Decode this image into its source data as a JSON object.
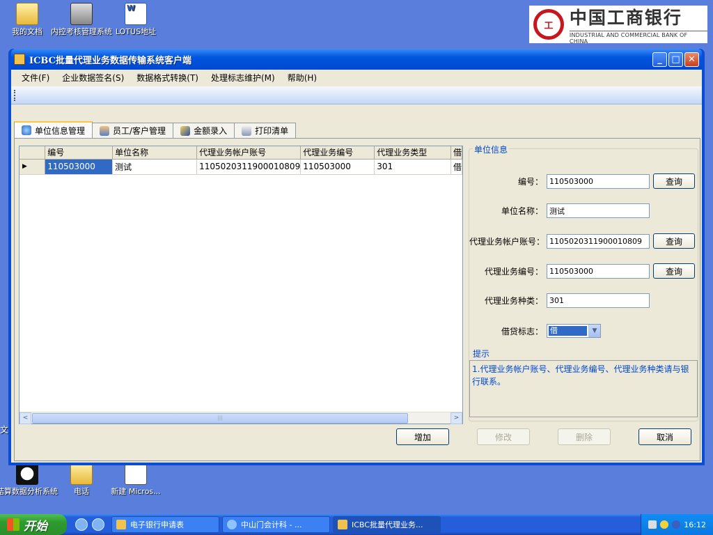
{
  "desktop": {
    "icons": [
      {
        "label": "我的文档"
      },
      {
        "label": "内控考核管理系统"
      },
      {
        "label": "LOTUS地址"
      },
      {
        "label": "结算数据分析系统"
      },
      {
        "label": "电话"
      },
      {
        "label": "新建 Micros..."
      }
    ],
    "side_char": "文"
  },
  "bank_logo": {
    "seal_text": "ICBC",
    "name_cn": "中国工商银行",
    "name_en": "INDUSTRIAL AND COMMERCIAL BANK OF CHINA"
  },
  "window": {
    "title": "ICBC批量代理业务数据传输系统客户端",
    "controls": {
      "minimize": "_",
      "maximize": "□",
      "close": "✕"
    }
  },
  "menu": [
    {
      "label": "文件(F)"
    },
    {
      "label": "企业数据签名(S)"
    },
    {
      "label": "数据格式转换(T)"
    },
    {
      "label": "处理标志维护(M)"
    },
    {
      "label": "帮助(H)"
    }
  ],
  "tabs": [
    {
      "label": "单位信息管理",
      "active": true
    },
    {
      "label": "员工/客户管理",
      "active": false
    },
    {
      "label": "金额录入",
      "active": false
    },
    {
      "label": "打印清单",
      "active": false
    }
  ],
  "grid": {
    "columns": [
      "编号",
      "单位名称",
      "代理业务帐户账号",
      "代理业务编号",
      "代理业务类型",
      "借"
    ],
    "rows": [
      {
        "marker": "▶",
        "cells": [
          "110503000",
          "测试",
          "1105020311900010809",
          "110503000",
          "301",
          "借"
        ]
      }
    ],
    "scroll_left": "<",
    "scroll_right": ">",
    "thumb_grip": "|||"
  },
  "unit_info": {
    "title": "单位信息",
    "fields": [
      {
        "label": "编号：",
        "value": "110503000",
        "button": "查询"
      },
      {
        "label": "单位名称：",
        "value": "测试",
        "button": null
      },
      {
        "label": "代理业务帐户账号：",
        "value": "1105020311900010809",
        "button": "查询"
      },
      {
        "label": "代理业务编号：",
        "value": "110503000",
        "button": "查询"
      },
      {
        "label": "代理业务种类：",
        "value": "301",
        "button": null
      }
    ],
    "debit_flag": {
      "label": "借贷标志：",
      "value": "借"
    }
  },
  "hint": {
    "title": "提示",
    "text": "1.代理业务帐户账号、代理业务编号、代理业务种类请与银行联系。"
  },
  "actions": {
    "add": "增加",
    "edit": "修改",
    "delete": "删除",
    "cancel": "取消"
  },
  "taskbar": {
    "start": "开始",
    "tasks": [
      {
        "label": "电子银行申请表",
        "active": false
      },
      {
        "label": "中山门会计科 - ...",
        "active": false
      },
      {
        "label": "ICBC批量代理业务...",
        "active": true
      }
    ],
    "clock": "16:12"
  },
  "colors": {
    "accent": "#0046d5",
    "selection": "#316ac5",
    "titlebar": "#0056e0",
    "desktop": "#5a7edc"
  }
}
